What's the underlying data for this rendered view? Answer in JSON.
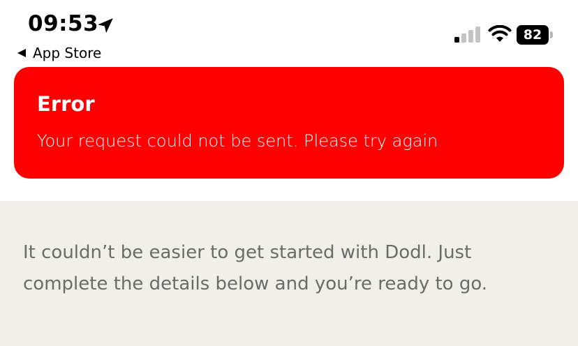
{
  "status_bar": {
    "time": "09:53",
    "back_label": "App Store",
    "battery_level": "82",
    "location_icon": "location-arrow-icon",
    "signal_icon": "cellular-signal-icon",
    "wifi_icon": "wifi-icon",
    "battery_icon": "battery-icon"
  },
  "error_banner": {
    "title": "Error",
    "message": "Your request could not be sent. Please try again",
    "background_color": "#fe0000"
  },
  "content": {
    "intro_text": "It couldn’t be easier to get started with Dodl. Just complete the details below and you’re ready to go.",
    "background_color": "#f0efe8"
  }
}
